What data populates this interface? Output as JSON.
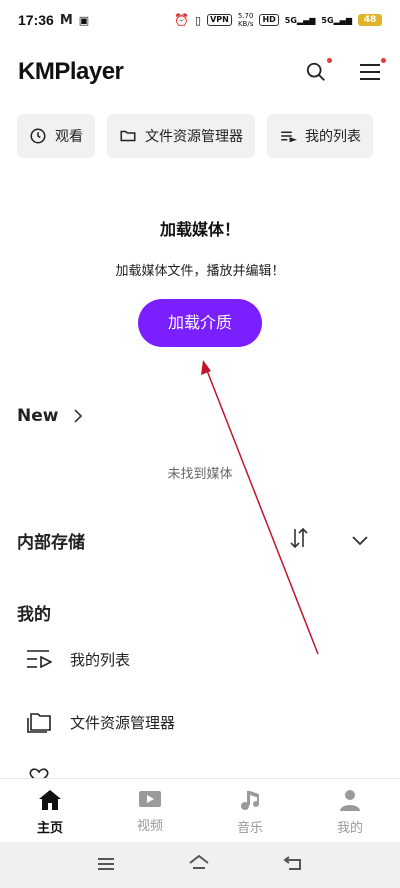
{
  "status_bar": {
    "time": "17:36",
    "vpn": "VPN",
    "speed": "5.70",
    "speed_unit": "KB/s",
    "hd": "HD",
    "net1": "5G",
    "net2": "5G",
    "battery": "48"
  },
  "header": {
    "brand": "KMPlayer"
  },
  "chips": [
    {
      "label": "观看",
      "icon": "clock-icon"
    },
    {
      "label": "文件资源管理器",
      "icon": "folder-icon"
    },
    {
      "label": "我的列表",
      "icon": "playlist-icon"
    }
  ],
  "load_media": {
    "title": "加载媒体！",
    "subtitle": "加载媒体文件，播放并编辑！",
    "button": "加载介质"
  },
  "new_section": {
    "title": "New",
    "empty": "未找到媒体"
  },
  "storage_section": {
    "title": "内部存储"
  },
  "mine_section": {
    "title": "我的",
    "items": [
      {
        "label": "我的列表",
        "icon": "playlist-icon"
      },
      {
        "label": "文件资源管理器",
        "icon": "folder-icon"
      }
    ]
  },
  "bottom_nav": [
    {
      "label": "主页",
      "icon": "home-icon",
      "active": true
    },
    {
      "label": "视频",
      "icon": "video-icon",
      "active": false
    },
    {
      "label": "音乐",
      "icon": "music-icon",
      "active": false
    },
    {
      "label": "我的",
      "icon": "person-icon",
      "active": false
    }
  ],
  "colors": {
    "accent": "#7a1fff",
    "chip_bg": "#f1f1f1",
    "annotation": "#c0152b"
  }
}
